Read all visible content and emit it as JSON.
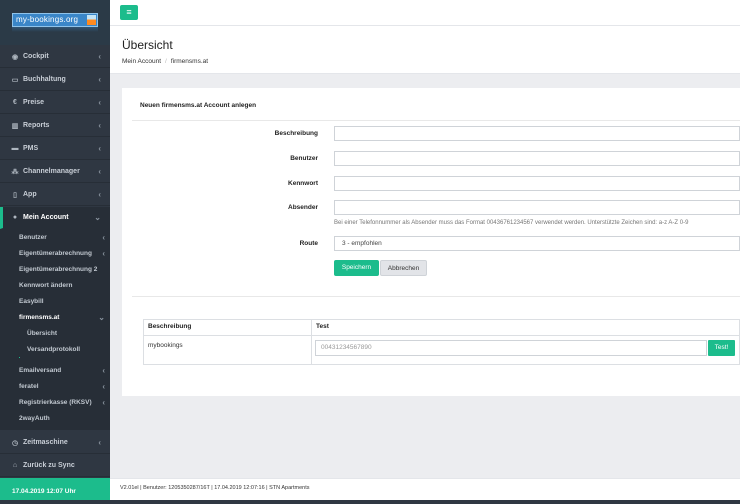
{
  "logo": {
    "text": "my-bookings.org"
  },
  "topbar": {
    "menu_icon": "hamburger-icon",
    "menu_glyph": "≡"
  },
  "sidebar": {
    "items": [
      {
        "label": "Cockpit",
        "icon": "dashboard-icon",
        "glyph": "◉"
      },
      {
        "label": "Buchhaltung",
        "icon": "folder-icon",
        "glyph": "▭"
      },
      {
        "label": "Preise",
        "icon": "euro-icon",
        "glyph": "€"
      },
      {
        "label": "Reports",
        "icon": "bar-chart-icon",
        "glyph": "▥"
      },
      {
        "label": "PMS",
        "icon": "bed-icon",
        "glyph": "▬"
      },
      {
        "label": "Channelmanager",
        "icon": "sitemap-icon",
        "glyph": "⁂"
      },
      {
        "label": "App",
        "icon": "mobile-icon",
        "glyph": "▯"
      },
      {
        "label": "Mein Account",
        "icon": "user-icon",
        "glyph": "●"
      }
    ],
    "sub_items": [
      {
        "label": "Benutzer"
      },
      {
        "label": "Eigentümerabrechnung"
      },
      {
        "label": "Eigentümerabrechnung 2"
      },
      {
        "label": "Kennwort ändern"
      },
      {
        "label": "Easybill"
      },
      {
        "label": "firmensms.at"
      }
    ],
    "subsub_items": [
      {
        "label": "Übersicht"
      },
      {
        "label": "Versandprotokoll"
      }
    ],
    "more_sub_items": [
      {
        "label": "Emailversand"
      },
      {
        "label": "feratel"
      },
      {
        "label": "Registrierkasse (RKSV)"
      },
      {
        "label": "2wayAuth"
      }
    ],
    "bottom_items": [
      {
        "label": "Zeitmaschine",
        "icon": "clock-icon",
        "glyph": "◷"
      },
      {
        "label": "Zurück zu Sync",
        "icon": "home-icon",
        "glyph": "⌂"
      }
    ],
    "footer_datetime": "17.04.2019 12:07 Uhr"
  },
  "header": {
    "title": "Übersicht",
    "breadcrumb": [
      "Mein Account",
      "firmensms.at"
    ]
  },
  "form": {
    "title": "Neuen firmensms.at Account anlegen",
    "fields": {
      "beschreibung": {
        "label": "Beschreibung",
        "value": ""
      },
      "benutzer": {
        "label": "Benutzer",
        "value": ""
      },
      "kennwort": {
        "label": "Kennwort",
        "value": ""
      },
      "absender": {
        "label": "Absender",
        "value": ""
      },
      "route": {
        "label": "Route",
        "value": "3 - empfohlen"
      }
    },
    "absender_hint": "Bei einer Telefonnummer als Absender muss das Format 00436761234567 verwendet werden. Unterstützte Zeichen sind: a-z A-Z 0-9",
    "save_label": "Speichern",
    "cancel_label": "Abbrechen"
  },
  "table": {
    "headers": [
      "Beschreibung",
      "Test"
    ],
    "rows": [
      {
        "beschreibung": "mybookings",
        "test_placeholder": "00431234567890",
        "test_button": "Test!"
      }
    ]
  },
  "footer": {
    "text": "V2.01el | Benutzer: 1205350287/16T | 17.04.2019 12:07:16 | STN Apartments"
  },
  "colors": {
    "accent": "#1cbc8c",
    "sidebar_bg": "#2f3742",
    "page_bg": "#ecedf0"
  }
}
